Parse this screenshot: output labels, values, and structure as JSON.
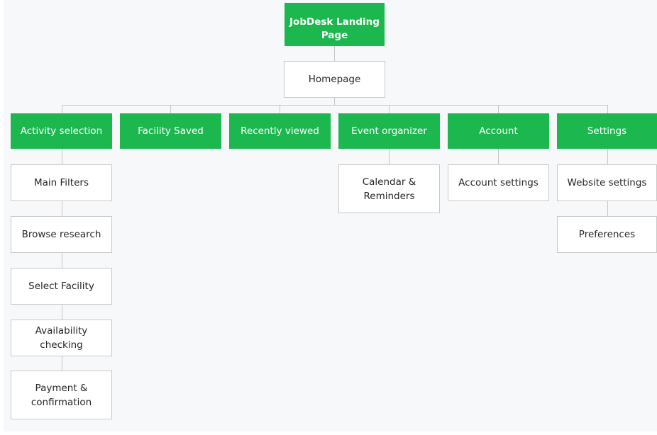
{
  "root": {
    "label": "JobDesk Landing Page"
  },
  "homepage": {
    "label": "Homepage"
  },
  "categories": [
    {
      "label": "Activity selection"
    },
    {
      "label": "Facility Saved"
    },
    {
      "label": "Recently viewed"
    },
    {
      "label": "Event organizer"
    },
    {
      "label": "Account"
    },
    {
      "label": "Settings"
    }
  ],
  "activity_children": [
    {
      "label": "Main Filters"
    },
    {
      "label": "Browse research"
    },
    {
      "label": "Select Facility"
    },
    {
      "label": "Availability checking"
    },
    {
      "label": "Payment & confirmation"
    }
  ],
  "event_children": [
    {
      "label": "Calendar & Reminders"
    }
  ],
  "account_children": [
    {
      "label": "Account settings"
    }
  ],
  "settings_children": [
    {
      "label": "Website settings"
    },
    {
      "label": "Preferences"
    }
  ],
  "colors": {
    "green": "#1cb84f",
    "connector": "#c6c6c6",
    "background": "#f7f8fa"
  }
}
